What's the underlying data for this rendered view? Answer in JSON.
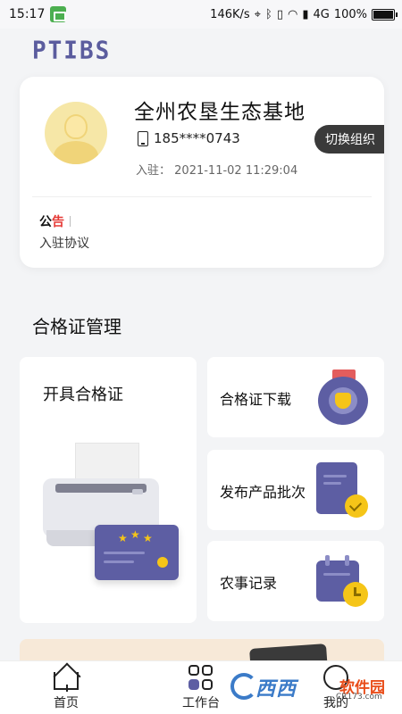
{
  "status_bar": {
    "time": "15:17",
    "speed": "146K/s",
    "network": "4G",
    "battery": "100%"
  },
  "header": {
    "logo": "PTIBS"
  },
  "profile": {
    "org_name": "全州农垦生态基地",
    "phone": "185****0743",
    "join_label": "入驻：",
    "join_time": "2021-11-02 11:29:04",
    "switch_label": "切换组织"
  },
  "notice": {
    "tag_part1": "公",
    "tag_part2": "告",
    "text": "入驻协议"
  },
  "section": {
    "title": "合格证管理"
  },
  "features": {
    "issue": "开具合格证",
    "download": "合格证下载",
    "publish_batch": "发布产品批次",
    "farm_record": "农事记录"
  },
  "bottom_nav": {
    "items": [
      {
        "label": "首页"
      },
      {
        "label": "工作台"
      },
      {
        "label": "我的"
      }
    ]
  },
  "watermark": {
    "brand": "西西",
    "sub": "软件园",
    "url": "CR173.com"
  },
  "colors": {
    "accent": "#5d5ea3",
    "gold": "#f5c518",
    "background": "#f3f4f6"
  }
}
